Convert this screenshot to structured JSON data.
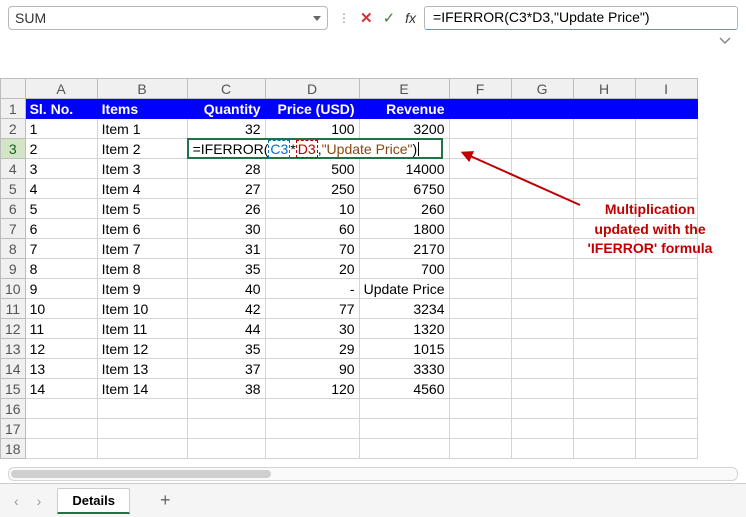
{
  "namebox": {
    "value": "SUM"
  },
  "formula_bar": {
    "value": "=IFERROR(C3*D3,\"Update Price\")"
  },
  "editing_formula": {
    "prefix": "=IFERROR(",
    "ref1": "C3",
    "op": "*",
    "ref2": "D3",
    "comma": ",",
    "str": "\"Update Price\"",
    "suffix": ")"
  },
  "columns": [
    "A",
    "B",
    "C",
    "D",
    "E",
    "F",
    "G",
    "H",
    "I"
  ],
  "row_numbers": [
    1,
    2,
    3,
    4,
    5,
    6,
    7,
    8,
    9,
    10,
    11,
    12,
    13,
    14,
    15,
    16,
    17,
    18
  ],
  "active_row": 3,
  "hdr": {
    "A": "Sl. No.",
    "B": "Items",
    "C": "Quantity",
    "D": "Price (USD)",
    "E": "Revenue"
  },
  "chart_data": {
    "type": "table",
    "title": "",
    "columns": [
      "Sl. No.",
      "Items",
      "Quantity",
      "Price (USD)",
      "Revenue"
    ],
    "rows": [
      {
        "sl": "1",
        "item": "Item 1",
        "qty": "32",
        "price": "100",
        "rev": "3200"
      },
      {
        "sl": "2",
        "item": "Item 2",
        "qty": "",
        "price": "",
        "rev": ""
      },
      {
        "sl": "3",
        "item": "Item 3",
        "qty": "28",
        "price": "500",
        "rev": "14000"
      },
      {
        "sl": "4",
        "item": "Item 4",
        "qty": "27",
        "price": "250",
        "rev": "6750"
      },
      {
        "sl": "5",
        "item": "Item 5",
        "qty": "26",
        "price": "10",
        "rev": "260"
      },
      {
        "sl": "6",
        "item": "Item 6",
        "qty": "30",
        "price": "60",
        "rev": "1800"
      },
      {
        "sl": "7",
        "item": "Item 7",
        "qty": "31",
        "price": "70",
        "rev": "2170"
      },
      {
        "sl": "8",
        "item": "Item 8",
        "qty": "35",
        "price": "20",
        "rev": "700"
      },
      {
        "sl": "9",
        "item": "Item 9",
        "qty": "40",
        "price": "-",
        "rev": "Update Price"
      },
      {
        "sl": "10",
        "item": "Item 10",
        "qty": "42",
        "price": "77",
        "rev": "3234"
      },
      {
        "sl": "11",
        "item": "Item 11",
        "qty": "44",
        "price": "30",
        "rev": "1320"
      },
      {
        "sl": "12",
        "item": "Item 12",
        "qty": "35",
        "price": "29",
        "rev": "1015"
      },
      {
        "sl": "13",
        "item": "Item 13",
        "qty": "37",
        "price": "90",
        "rev": "3330"
      },
      {
        "sl": "14",
        "item": "Item 14",
        "qty": "38",
        "price": "120",
        "rev": "4560"
      }
    ]
  },
  "annotation": {
    "line1": "Multiplication",
    "line2": "updated with the",
    "line3": "'IFERROR' formula"
  },
  "tabs": {
    "active": "Details",
    "add": "+"
  },
  "nav": {
    "prev": "‹",
    "next": "›"
  }
}
